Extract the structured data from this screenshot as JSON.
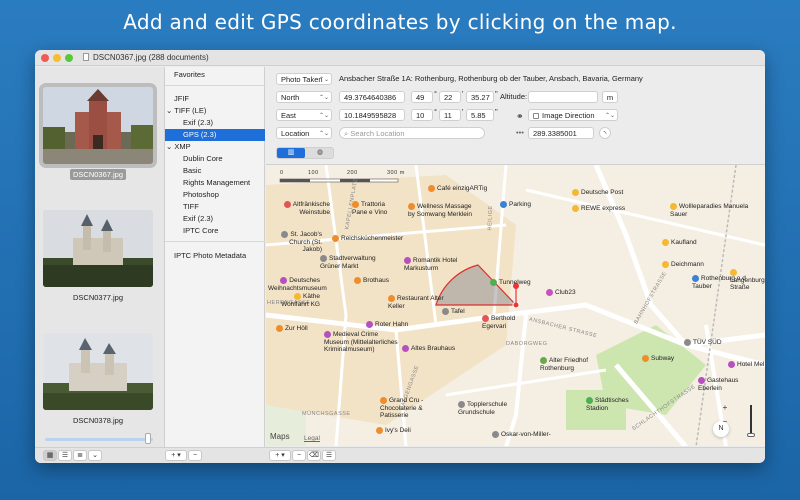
{
  "headline": "Add and edit GPS coordinates by clicking on the map.",
  "window": {
    "title": "DSCN0367.jpg (288 documents)"
  },
  "traffic_colors": {
    "close": "#ee5d55",
    "minimize": "#f5bd2f",
    "zoom": "#5ac83d"
  },
  "thumbnails": [
    {
      "caption": "DSCN0367.jpg",
      "selected": true
    },
    {
      "caption": "DSCN0377.jpg",
      "selected": false
    },
    {
      "caption": "DSCN0378.jpg",
      "selected": false
    }
  ],
  "tree": {
    "favorites": "Favorites",
    "jfif": "JFIF",
    "tiff_le": "TIFF (LE)",
    "exif_23": "Exif (2.3)",
    "gps_23": "GPS (2.3)",
    "xmp": "XMP",
    "dublin_core": "Dublin Core",
    "basic": "Basic",
    "rights": "Rights Management",
    "photoshop": "Photoshop",
    "tiff": "TIFF",
    "exif_23b": "Exif (2.3)",
    "iptc_core": "IPTC Core",
    "iptc_photo": "IPTC Photo Metadata"
  },
  "form": {
    "photo_taken": "Photo Taken",
    "address": "Ansbacher Straße 1A: Rothenburg, Rothenburg ob der Tauber, Ansbach, Bavaria, Germany",
    "north": "North",
    "lat_decimal": "49.3764640386",
    "lat_deg": "49",
    "lat_min": "22",
    "lat_sec": "35.27",
    "altitude_label": "Altitude:",
    "altitude_value": "",
    "altitude_unit": "m",
    "east": "East",
    "lon_decimal": "10.1849595828",
    "lon_deg": "10",
    "lon_min": "11",
    "lon_sec": "5.85",
    "image_direction": "Image Direction",
    "location": "Location",
    "search_placeholder": "Search Location",
    "direction_value": "289.3385001",
    "deg_mark": "°",
    "min_mark": "'",
    "sec_mark": "\""
  },
  "map": {
    "scale": [
      "0",
      "100",
      "200",
      "300 m"
    ],
    "legal": "Legal",
    "maps_label": "Maps",
    "compass": "N",
    "zoom_in": "+",
    "zoom_out": "−",
    "pois": [
      {
        "name": "Café einzigARTig",
        "color": "#f08c2a"
      },
      {
        "name": "Deutsche Post",
        "color": "#f5b82e"
      },
      {
        "name": "Altfränkische Weinstube",
        "color": "#e25555"
      },
      {
        "name": "Trattoria Pane e Vino",
        "color": "#f08c2a"
      },
      {
        "name": "Wellness Massage by Somwang Merklein",
        "color": "#f08c2a"
      },
      {
        "name": "Parking",
        "color": "#3b82d6"
      },
      {
        "name": "REWE express",
        "color": "#f5b82e"
      },
      {
        "name": "Wollleparadies Manuela Sauer",
        "color": "#f5b82e"
      },
      {
        "name": "St. Jacob's Church (St. Jakob)",
        "color": "#8a8a8a"
      },
      {
        "name": "Reichsküchenmeister",
        "color": "#f08c2a"
      },
      {
        "name": "Kaufland",
        "color": "#f5b82e"
      },
      {
        "name": "Stadtverwaltung Grüner Markt",
        "color": "#8a8a8a"
      },
      {
        "name": "Romantik Hotel Markusturm",
        "color": "#b84fc0"
      },
      {
        "name": "Deichmann",
        "color": "#f5b82e"
      },
      {
        "name": "Deutsches Weihnachtsmuseum",
        "color": "#b84fc0"
      },
      {
        "name": "Brothaus",
        "color": "#f08c2a"
      },
      {
        "name": "Tunnelweg",
        "color": "#4caf50"
      },
      {
        "name": "Club23",
        "color": "#c850c0"
      },
      {
        "name": "Rothenburg o d Tauber",
        "color": "#3b82d6"
      },
      {
        "name": "Langenburger Straße",
        "color": "#f5b82e"
      },
      {
        "name": "Käthe Wohlfahrt KG",
        "color": "#f5b82e"
      },
      {
        "name": "Restaurant Alter Keller",
        "color": "#f08c2a"
      },
      {
        "name": "Tafel",
        "color": "#8a8a8a"
      },
      {
        "name": "Zur Höll",
        "color": "#f08c2a"
      },
      {
        "name": "Roter Hahn",
        "color": "#b84fc0"
      },
      {
        "name": "Berthold Egervari",
        "color": "#e25555"
      },
      {
        "name": "Medieval Crime Museum (Mittelalterliches Kriminalmuseum)",
        "color": "#b84fc0"
      },
      {
        "name": "Altes Brauhaus",
        "color": "#b84fc0"
      },
      {
        "name": "Alter Friedhof Rothenburg",
        "color": "#6aa84f"
      },
      {
        "name": "TÜV SÜD",
        "color": "#8a8a8a"
      },
      {
        "name": "Subway",
        "color": "#f08c2a"
      },
      {
        "name": "Hotel Mel",
        "color": "#b84fc0"
      },
      {
        "name": "Gastehaus Eberlein",
        "color": "#b84fc0"
      },
      {
        "name": "Grand Cru - Chocolaterie & Patisserie",
        "color": "#f08c2a"
      },
      {
        "name": "Topplerschule Grundschule",
        "color": "#8a8a8a"
      },
      {
        "name": "Städtisches Stadion",
        "color": "#4caf50"
      },
      {
        "name": "Ivy's Deli",
        "color": "#f08c2a"
      },
      {
        "name": "Oskar-von-Miller-",
        "color": "#8a8a8a"
      }
    ],
    "streets": [
      "ANSBACHER STRASSE",
      "BAHNHOFSTRASSE",
      "SCHLACHTHOFSTRASSE",
      "GALGENGASSE",
      "DABORGWEG",
      "HEILIGE",
      "MÜNCHSGASSE",
      "KAPELLENPLATZ",
      "HERRNGASSE"
    ]
  },
  "bottom": {
    "add": "+ ▾",
    "remove": "−",
    "add2": "+ ▾",
    "remove2": "−"
  }
}
